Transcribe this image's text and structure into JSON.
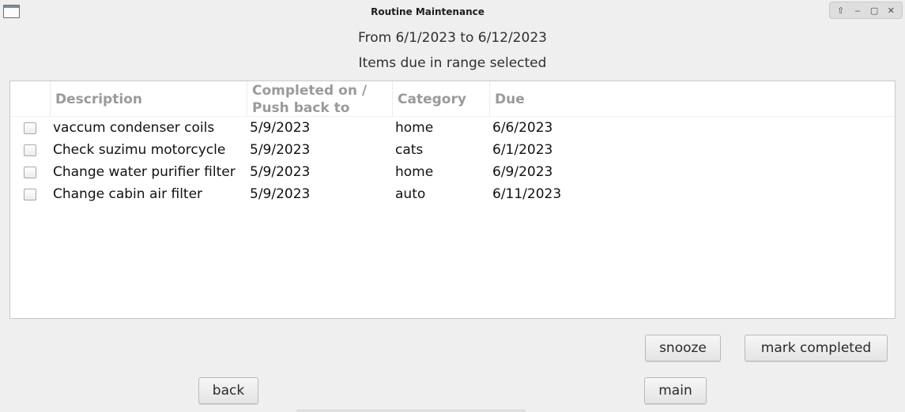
{
  "window": {
    "title": "Routine Maintenance",
    "icon": "window-icon",
    "controls": [
      {
        "name": "up-arrow-icon",
        "glyph": "⇧"
      },
      {
        "name": "minimize-icon",
        "glyph": "‒"
      },
      {
        "name": "maximize-icon",
        "glyph": "▢"
      },
      {
        "name": "close-icon",
        "glyph": "✕"
      }
    ]
  },
  "header": {
    "range_text": "From 6/1/2023 to 6/12/2023",
    "subtitle": "Items due in range selected"
  },
  "table": {
    "columns": {
      "description": "Description",
      "completed": "Completed on /\nPush back to",
      "category": "Category",
      "due": "Due"
    },
    "rows": [
      {
        "checked": false,
        "description": "vaccum condenser coils",
        "completed": "5/9/2023",
        "category": "home",
        "due": "6/6/2023"
      },
      {
        "checked": false,
        "description": "Check suzimu motorcycle",
        "completed": "5/9/2023",
        "category": "cats",
        "due": "6/1/2023"
      },
      {
        "checked": false,
        "description": "Change water purifier filter",
        "completed": "5/9/2023",
        "category": "home",
        "due": "6/9/2023"
      },
      {
        "checked": false,
        "description": "Change cabin air filter",
        "completed": "5/9/2023",
        "category": "auto",
        "due": "6/11/2023"
      }
    ]
  },
  "buttons": {
    "snooze": "snooze",
    "mark_completed": "mark completed",
    "back": "back",
    "main": "main"
  }
}
